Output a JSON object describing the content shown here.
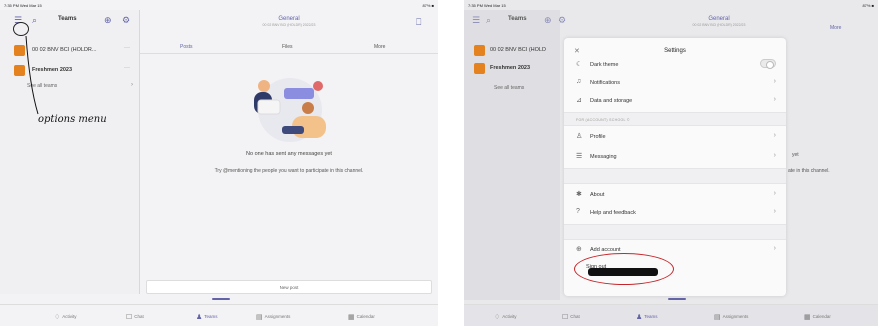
{
  "left": {
    "statusbar": {
      "time": "7:35 PM  Wed Mar 15",
      "battery": "87% ■"
    },
    "sidebar": {
      "title": "Teams",
      "teams": [
        {
          "name": "00 02 BNV BCI (HOLDR...",
          "more": "···"
        },
        {
          "name": "Freshmen 2023",
          "more": "···"
        }
      ],
      "see_all": "See all teams",
      "see_all_chevron": "›"
    },
    "annotation": "options menu",
    "channel": {
      "title": "General",
      "subtitle": "00 02 BNV BCI (HOLDR) 2022/23"
    },
    "tabs": [
      {
        "label": "Posts",
        "active": true
      },
      {
        "label": "Files",
        "active": false
      },
      {
        "label": "More",
        "active": false
      }
    ],
    "empty_state": {
      "title": "No one has sent any messages yet",
      "subtitle": "Try @mentioning the people you want to participate in this channel."
    },
    "new_conversation": "New post",
    "bottom_nav": [
      {
        "icon": "bell-icon",
        "label": "Activity"
      },
      {
        "icon": "chat-icon",
        "label": "Chat"
      },
      {
        "icon": "teams-icon",
        "label": "Teams",
        "active": true
      },
      {
        "icon": "assignments-icon",
        "label": "Assignments"
      },
      {
        "icon": "calendar-icon",
        "label": "Calendar"
      }
    ]
  },
  "right": {
    "statusbar": {
      "time": "7:35 PM  Wed Mar 15",
      "battery": "87% ■"
    },
    "sidebar": {
      "title": "Teams",
      "teams": [
        {
          "name": "00 02 BNV BCI (HOLD"
        },
        {
          "name": "Freshmen 2023"
        }
      ],
      "see_all": "See all teams"
    },
    "channel": {
      "title": "General",
      "subtitle": "00 02 BNV BCI (HOLDR) 2022/23",
      "more_tab": "More"
    },
    "background_text": {
      "fragment1": "yet",
      "fragment2": "ate in this channel."
    },
    "settings": {
      "title": "Settings",
      "close": "✕",
      "items_top": [
        {
          "icon": "moon-icon",
          "glyph": "☾",
          "label": "Dark theme",
          "toggle": true
        },
        {
          "icon": "bell-icon",
          "glyph": "♫",
          "label": "Notifications",
          "chevron": "›"
        },
        {
          "icon": "data-icon",
          "glyph": "⊿",
          "label": "Data and storage",
          "chevron": "›"
        }
      ],
      "section_label": "FOR (ACCOUNT) SCHOOL ©",
      "items_mid": [
        {
          "icon": "profile-icon",
          "glyph": "♙",
          "label": "Profile",
          "chevron": "›"
        },
        {
          "icon": "messaging-icon",
          "glyph": "☰",
          "label": "Messaging",
          "chevron": "›"
        }
      ],
      "items_about": [
        {
          "icon": "info-icon",
          "glyph": "✱",
          "label": "About",
          "chevron": "›"
        },
        {
          "icon": "help-icon",
          "glyph": "?",
          "label": "Help and feedback",
          "chevron": "›"
        }
      ],
      "items_account": [
        {
          "icon": "add-account-icon",
          "glyph": "⊕",
          "label": "Add account",
          "chevron": "›"
        },
        {
          "label": "Sign out"
        }
      ]
    },
    "bottom_nav": [
      {
        "icon": "bell-icon",
        "label": "Activity"
      },
      {
        "icon": "chat-icon",
        "label": "Chat"
      },
      {
        "icon": "teams-icon",
        "label": "Teams",
        "active": true
      },
      {
        "icon": "assignments-icon",
        "label": "Assignments"
      },
      {
        "icon": "calendar-icon",
        "label": "Calendar"
      }
    ]
  },
  "colors": {
    "accent": "#6264a7",
    "team_logo": "#e3821f",
    "annotation_red": "#c6262b"
  }
}
